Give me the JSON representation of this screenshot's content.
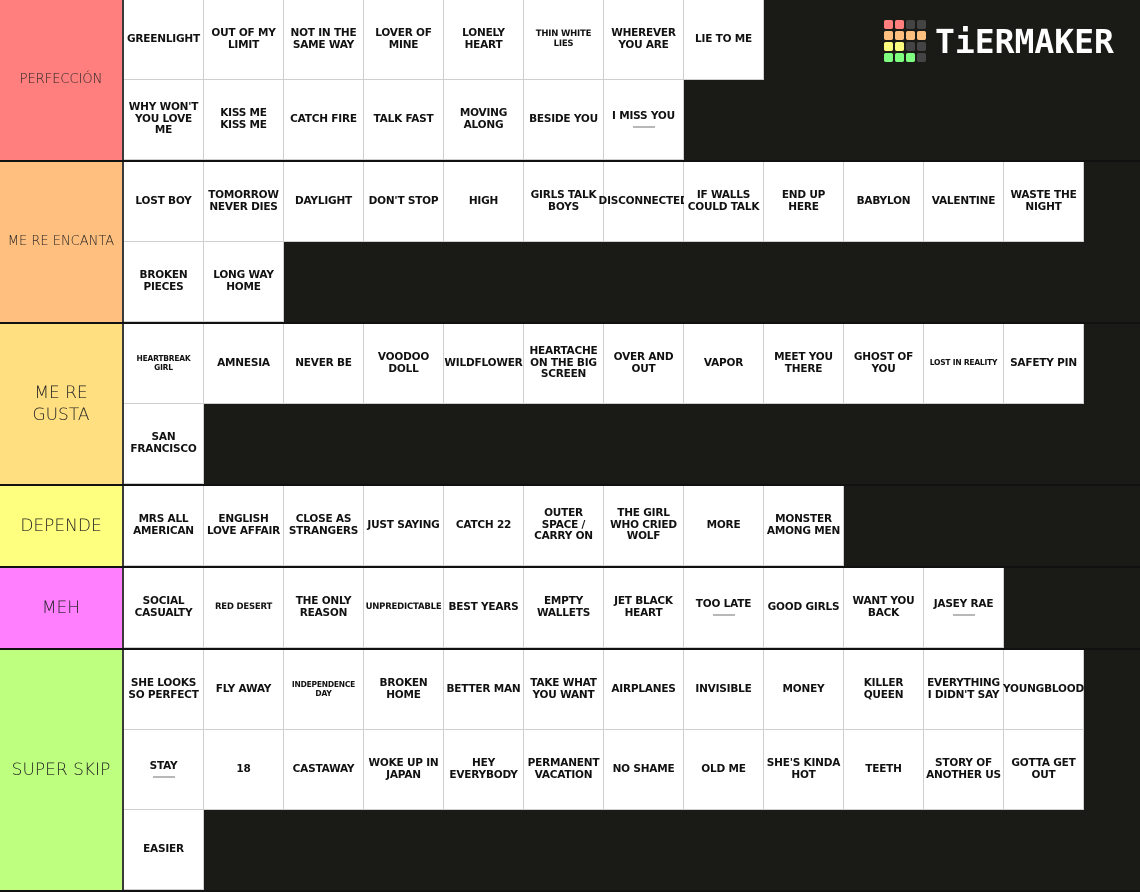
{
  "logo": {
    "text": "TiERMAKER",
    "grid_colors": [
      "#ff7f7f",
      "#ff7f7f",
      "#444444",
      "#444444",
      "#ffbf7f",
      "#ffbf7f",
      "#ffbf7f",
      "#ffbf7f",
      "#ffff7f",
      "#ffff7f",
      "#444444",
      "#444444",
      "#7fff7f",
      "#7fff7f",
      "#7fff7f",
      "#444444"
    ]
  },
  "background_color": "#1a1a17",
  "tiers": [
    {
      "label": "PERFECCIÓN",
      "color": "#ff7f7f",
      "items": [
        {
          "title": "GREENLIGHT"
        },
        {
          "title": "OUT OF MY LIMIT"
        },
        {
          "title": "NOT IN THE SAME WAY"
        },
        {
          "title": "LOVER OF MINE"
        },
        {
          "title": "LONELY HEART"
        },
        {
          "title": "THIN WHITE LIES",
          "size": "small"
        },
        {
          "title": "WHEREVER YOU ARE"
        },
        {
          "title": "LIE TO ME"
        },
        {
          "title": "WHY WON'T YOU LOVE ME"
        },
        {
          "title": "KISS ME KISS ME"
        },
        {
          "title": "CATCH FIRE"
        },
        {
          "title": "TALK FAST"
        },
        {
          "title": "MOVING ALONG"
        },
        {
          "title": "BESIDE YOU"
        },
        {
          "title": "I MISS YOU",
          "has_subcaption": true
        }
      ],
      "row_breaks": [
        8
      ]
    },
    {
      "label": "ME RE ENCANTA",
      "color": "#ffbf7f",
      "items": [
        {
          "title": "LOST BOY"
        },
        {
          "title": "TOMORROW NEVER DIES"
        },
        {
          "title": "DAYLIGHT"
        },
        {
          "title": "DON'T STOP"
        },
        {
          "title": "HIGH"
        },
        {
          "title": "GIRLS TALK BOYS"
        },
        {
          "title": "DISCONNECTED"
        },
        {
          "title": "IF WALLS COULD TALK"
        },
        {
          "title": "END UP HERE"
        },
        {
          "title": "BABYLON"
        },
        {
          "title": "VALENTINE"
        },
        {
          "title": "WASTE THE NIGHT"
        },
        {
          "title": "BROKEN PIECES"
        },
        {
          "title": "LONG WAY HOME"
        }
      ]
    },
    {
      "label": "ME RE GUSTA",
      "color": "#ffdf80",
      "items": [
        {
          "title": "HEARTBREAK GIRL",
          "size": "tiny"
        },
        {
          "title": "AMNESIA"
        },
        {
          "title": "NEVER BE"
        },
        {
          "title": "VOODOO DOLL"
        },
        {
          "title": "WILDFLOWER"
        },
        {
          "title": "HEARTACHE ON THE BIG SCREEN"
        },
        {
          "title": "OVER AND OUT"
        },
        {
          "title": "VAPOR"
        },
        {
          "title": "MEET YOU THERE"
        },
        {
          "title": "GHOST OF YOU"
        },
        {
          "title": "LOST IN REALITY",
          "size": "tiny"
        },
        {
          "title": "SAFETY PIN"
        },
        {
          "title": "SAN FRANCISCO"
        }
      ]
    },
    {
      "label": "DEPENDE",
      "color": "#ffff7f",
      "items": [
        {
          "title": "MRS ALL AMERICAN"
        },
        {
          "title": "ENGLISH LOVE AFFAIR"
        },
        {
          "title": "CLOSE AS STRANGERS"
        },
        {
          "title": "JUST SAYING"
        },
        {
          "title": "CATCH 22"
        },
        {
          "title": "OUTER SPACE / CARRY ON"
        },
        {
          "title": "THE GIRL WHO CRIED WOLF"
        },
        {
          "title": "MORE"
        },
        {
          "title": "MONSTER AMONG MEN"
        }
      ]
    },
    {
      "label": "MEH",
      "color": "#ff7fff",
      "items": [
        {
          "title": "SOCIAL CASUALTY"
        },
        {
          "title": "RED DESERT",
          "size": "small"
        },
        {
          "title": "THE ONLY REASON"
        },
        {
          "title": "UNPREDICTABLE",
          "size": "small"
        },
        {
          "title": "BEST YEARS"
        },
        {
          "title": "EMPTY WALLETS"
        },
        {
          "title": "JET BLACK HEART"
        },
        {
          "title": "TOO LATE",
          "has_subcaption": true
        },
        {
          "title": "GOOD GIRLS"
        },
        {
          "title": "WANT YOU BACK"
        },
        {
          "title": "JASEY RAE",
          "has_subcaption": true
        }
      ]
    },
    {
      "label": "SUPER SKIP",
      "color": "#bfff7f",
      "items": [
        {
          "title": "SHE LOOKS SO PERFECT"
        },
        {
          "title": "FLY AWAY"
        },
        {
          "title": "INDEPENDENCE DAY",
          "size": "tiny"
        },
        {
          "title": "BROKEN HOME"
        },
        {
          "title": "BETTER MAN"
        },
        {
          "title": "TAKE WHAT YOU WANT"
        },
        {
          "title": "AIRPLANES"
        },
        {
          "title": "INVISIBLE"
        },
        {
          "title": "MONEY"
        },
        {
          "title": "KILLER QUEEN"
        },
        {
          "title": "EVERYTHING I DIDN'T SAY"
        },
        {
          "title": "YOUNGBLOOD"
        },
        {
          "title": "STAY",
          "has_subcaption": true
        },
        {
          "title": "18"
        },
        {
          "title": "CASTAWAY"
        },
        {
          "title": "WOKE UP IN JAPAN"
        },
        {
          "title": "HEY EVERYBODY"
        },
        {
          "title": "PERMANENT VACATION"
        },
        {
          "title": "NO SHAME"
        },
        {
          "title": "OLD ME"
        },
        {
          "title": "SHE'S KINDA HOT"
        },
        {
          "title": "TEETH"
        },
        {
          "title": "STORY OF ANOTHER US"
        },
        {
          "title": "GOTTA GET OUT"
        },
        {
          "title": "EASIER"
        }
      ]
    }
  ]
}
